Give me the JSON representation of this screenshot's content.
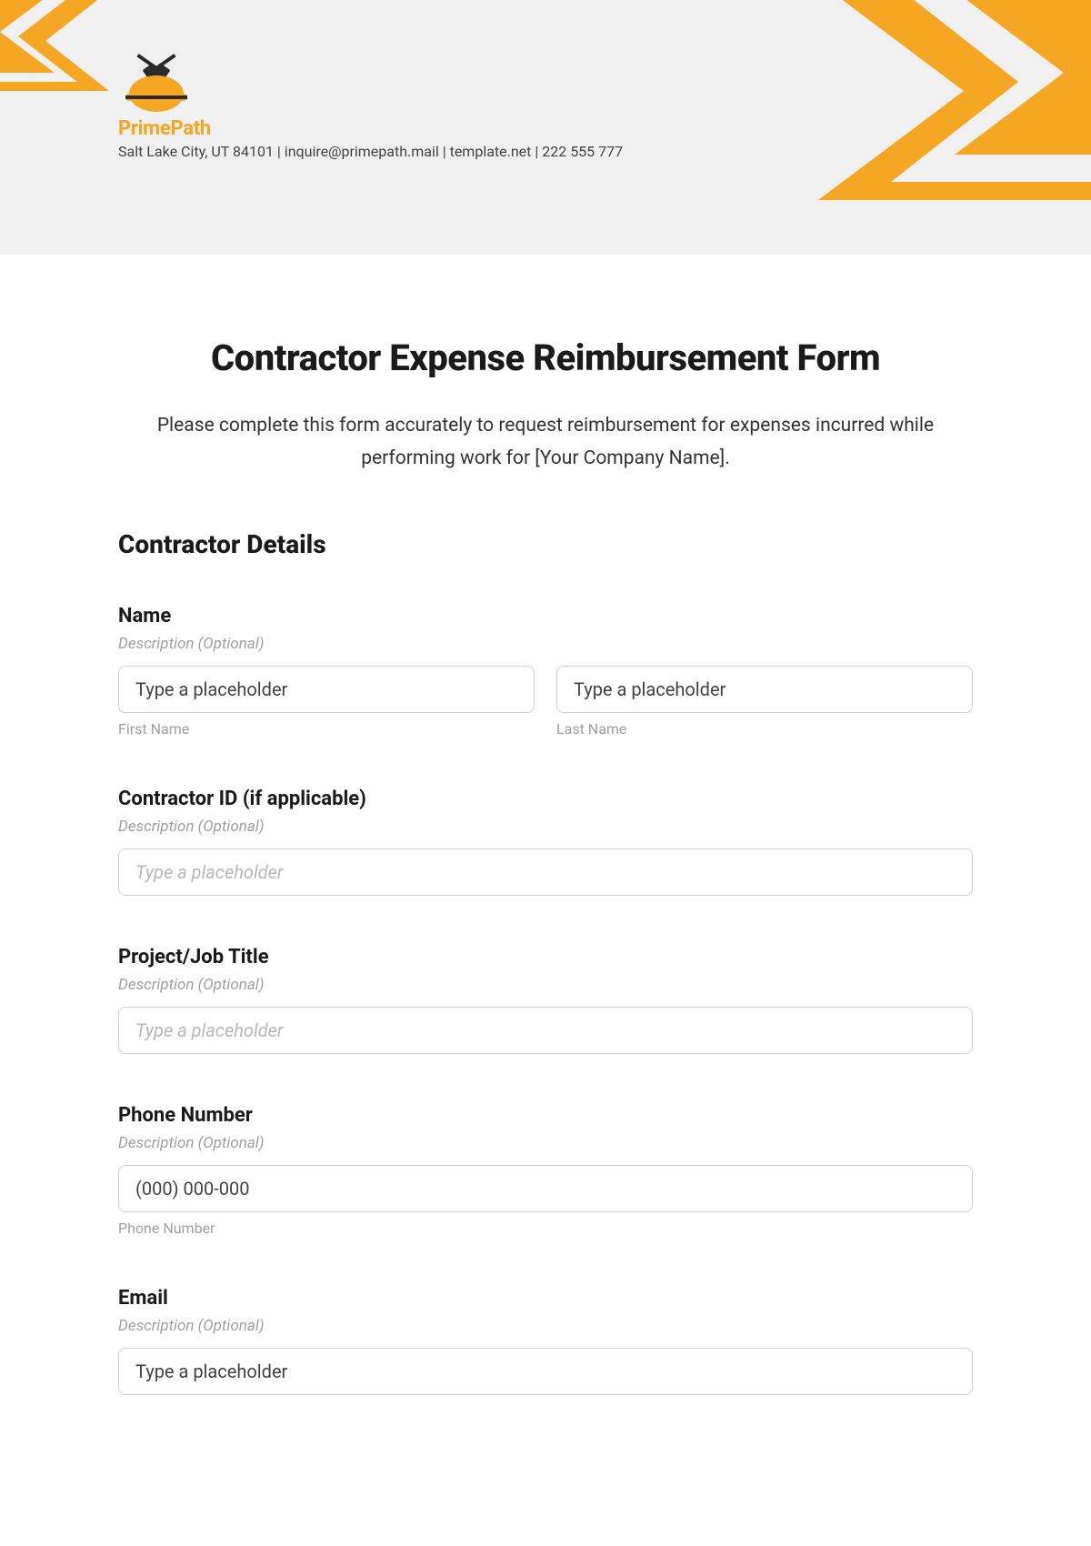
{
  "header": {
    "company_name": "PrimePath",
    "company_info": "Salt Lake City, UT 84101 | inquire@primepath.mail | template.net | 222 555 777"
  },
  "main": {
    "title": "Contractor Expense Reimbursement Form",
    "intro": "Please complete this form accurately to request reimbursement for expenses incurred while performing work for [Your Company Name].",
    "section_heading": "Contractor Details"
  },
  "fields": {
    "name": {
      "label": "Name",
      "desc": "Description (Optional)",
      "first_placeholder": "Type a placeholder",
      "first_sublabel": "First Name",
      "last_placeholder": "Type a placeholder",
      "last_sublabel": "Last Name"
    },
    "contractor_id": {
      "label": "Contractor ID (if applicable)",
      "desc": "Description (Optional)",
      "placeholder": "Type a placeholder"
    },
    "project": {
      "label": "Project/Job Title",
      "desc": "Description (Optional)",
      "placeholder": "Type a placeholder"
    },
    "phone": {
      "label": "Phone Number",
      "desc": "Description (Optional)",
      "placeholder": "(000) 000-000",
      "sublabel": "Phone Number"
    },
    "email": {
      "label": "Email",
      "desc": "Description (Optional)",
      "placeholder": "Type a placeholder"
    }
  }
}
